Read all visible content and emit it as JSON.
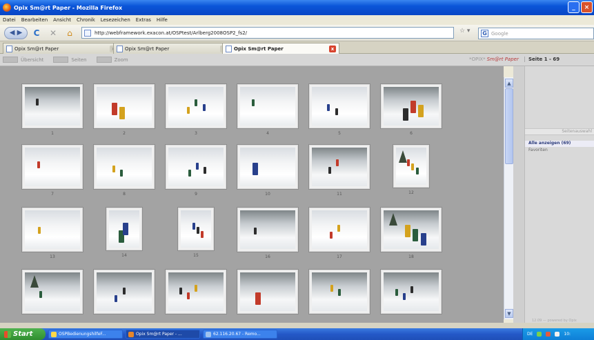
{
  "window": {
    "title": "Opix Sm@rt Paper - Mozilla Firefox"
  },
  "menu": [
    "Datei",
    "Bearbeiten",
    "Ansicht",
    "Chronik",
    "Lesezeichen",
    "Extras",
    "Hilfe"
  ],
  "navbar": {
    "url": "http://webframework.exacon.at/OSPtest/Arlberg2008OSP2_fs2/",
    "search_placeholder": "Google"
  },
  "tabs": [
    {
      "label": "Opix Sm@rt Paper",
      "active": false
    },
    {
      "label": "Opix Sm@rt Paper",
      "active": false
    },
    {
      "label": "Opix Sm@rt Paper",
      "active": true
    }
  ],
  "app_toolbar": {
    "buttons": [
      "Übersicht",
      "Seiten",
      "Zoom"
    ],
    "brand_prefix": "*OPIX*",
    "brand": "Sm@rt Paper",
    "page_info": "Seite 1 - 69"
  },
  "thumbnails": [
    {
      "num": "1"
    },
    {
      "num": "2"
    },
    {
      "num": "3"
    },
    {
      "num": "4"
    },
    {
      "num": "5"
    },
    {
      "num": "6"
    },
    {
      "num": "7"
    },
    {
      "num": "8"
    },
    {
      "num": "9"
    },
    {
      "num": "10"
    },
    {
      "num": "11"
    },
    {
      "num": "12"
    },
    {
      "num": "13"
    },
    {
      "num": "14"
    },
    {
      "num": "15"
    },
    {
      "num": "16"
    },
    {
      "num": "17"
    },
    {
      "num": "18"
    },
    {
      "num": ""
    },
    {
      "num": ""
    },
    {
      "num": ""
    },
    {
      "num": ""
    },
    {
      "num": ""
    },
    {
      "num": ""
    }
  ],
  "right_panel": {
    "header": "Seitenauswahl",
    "selected": "Alle anzeigen (69)",
    "item": "Favoriten",
    "footer": "12.09 — powered by Opix"
  },
  "taskbar": {
    "start": "Start",
    "items": [
      {
        "label": "OSPBedienungshilfeF...",
        "active": false
      },
      {
        "label": "Opix Sm@rt Paper - ...",
        "active": true
      },
      {
        "label": "62.116.20.67 - Remo...",
        "active": false
      }
    ],
    "tray_lang": "DE",
    "tray_time": "10:"
  }
}
